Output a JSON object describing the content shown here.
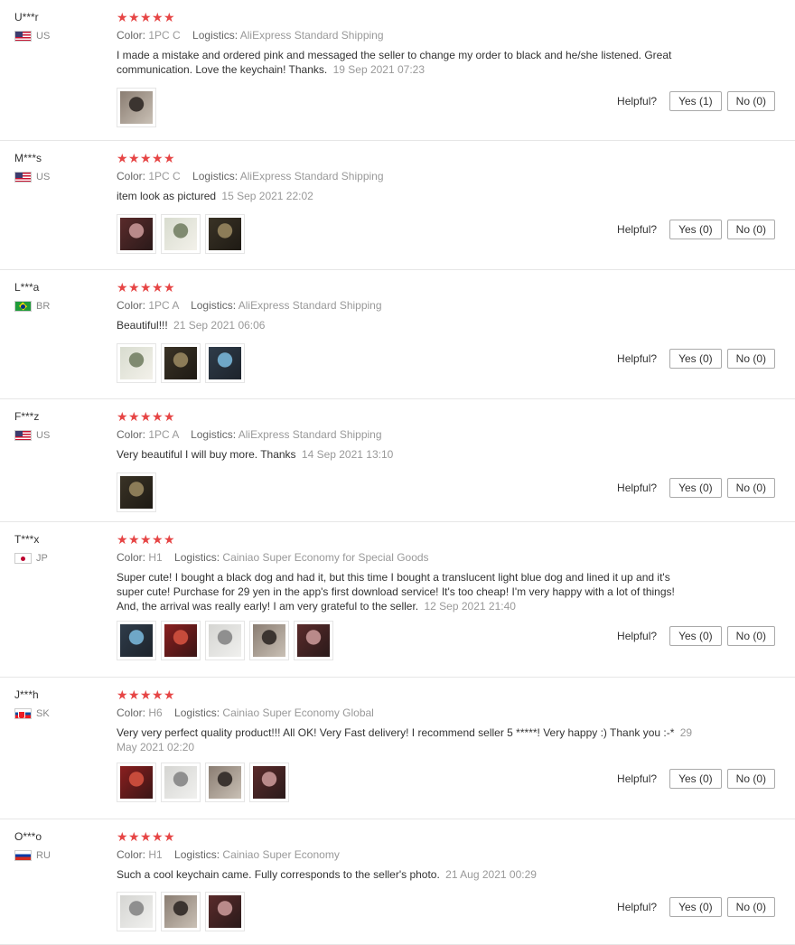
{
  "helpful_label": "Helpful?",
  "colors": {
    "stars": "#e64545"
  },
  "reviews": [
    {
      "name": "U***r",
      "country": "US",
      "flag": "us-flag-icon",
      "rating": 5,
      "color_label": "Color:",
      "color": "1PC C",
      "logistics_label": "Logistics:",
      "logistics": "AliExpress Standard Shipping",
      "text": "I made a mistake and ordered pink and messaged the seller to change my order to black and he/she listened. Great communication. Love the keychain! Thanks.",
      "date": "19 Sep 2021 07:23",
      "yes": "Yes (1)",
      "no": "No (0)",
      "photos": [
        "photo-keychain"
      ]
    },
    {
      "name": "M***s",
      "country": "US",
      "flag": "us-flag-icon",
      "rating": 5,
      "color_label": "Color:",
      "color": "1PC C",
      "logistics_label": "Logistics:",
      "logistics": "AliExpress Standard Shipping",
      "text": "item look as pictured",
      "date": "15 Sep 2021 22:02",
      "yes": "Yes (0)",
      "no": "No (0)",
      "photos": [
        "photo-keychain",
        "photo-keychain",
        "photo-keychain"
      ]
    },
    {
      "name": "L***a",
      "country": "BR",
      "flag": "br-flag-icon",
      "rating": 5,
      "color_label": "Color:",
      "color": "1PC A",
      "logistics_label": "Logistics:",
      "logistics": "AliExpress Standard Shipping",
      "text": "Beautiful!!!",
      "date": "21 Sep 2021 06:06",
      "yes": "Yes (0)",
      "no": "No (0)",
      "photos": [
        "photo-keychain",
        "photo-keychain",
        "photo-keychain"
      ]
    },
    {
      "name": "F***z",
      "country": "US",
      "flag": "us-flag-icon",
      "rating": 5,
      "color_label": "Color:",
      "color": "1PC A",
      "logistics_label": "Logistics:",
      "logistics": "AliExpress Standard Shipping",
      "text": "Very beautiful I will buy more. Thanks",
      "date": "14 Sep 2021 13:10",
      "yes": "Yes (0)",
      "no": "No (0)",
      "photos": [
        "photo-keychain"
      ]
    },
    {
      "name": "T***x",
      "country": "JP",
      "flag": "jp-flag-icon",
      "rating": 5,
      "color_label": "Color:",
      "color": "H1",
      "logistics_label": "Logistics:",
      "logistics": "Cainiao Super Economy for Special Goods",
      "text": "Super cute! I bought a black dog and had it, but this time I bought a translucent light blue dog and lined it up and it's super cute! Purchase for 29 yen in the app's first download service! It's too cheap! I'm very happy with a lot of things! And, the arrival was really early! I am very grateful to the seller.",
      "date": "12 Sep 2021 21:40",
      "yes": "Yes (0)",
      "no": "No (0)",
      "photos": [
        "photo-keychain",
        "photo-keychain",
        "photo-keychain",
        "photo-keychain",
        "photo-keychain"
      ]
    },
    {
      "name": "J***h",
      "country": "SK",
      "flag": "sk-flag-icon",
      "rating": 5,
      "color_label": "Color:",
      "color": "H6",
      "logistics_label": "Logistics:",
      "logistics": "Cainiao Super Economy Global",
      "text": "Very very perfect quality product!!! All OK! Very Fast delivery! I recommend seller 5 *****! Very happy :) Thank you :-*",
      "date": "29 May 2021 02:20",
      "yes": "Yes (0)",
      "no": "No (0)",
      "photos": [
        "photo-keychain",
        "photo-keychain",
        "photo-keychain",
        "photo-keychain"
      ]
    },
    {
      "name": "O***o",
      "country": "RU",
      "flag": "ru-flag-icon",
      "rating": 5,
      "color_label": "Color:",
      "color": "H1",
      "logistics_label": "Logistics:",
      "logistics": "Cainiao Super Economy",
      "text": "Such a cool keychain came. Fully corresponds to the seller's photo.",
      "date": "21 Aug 2021 00:29",
      "yes": "Yes (0)",
      "no": "No (0)",
      "photos": [
        "photo-keychain",
        "photo-keychain",
        "photo-keychain"
      ]
    }
  ]
}
